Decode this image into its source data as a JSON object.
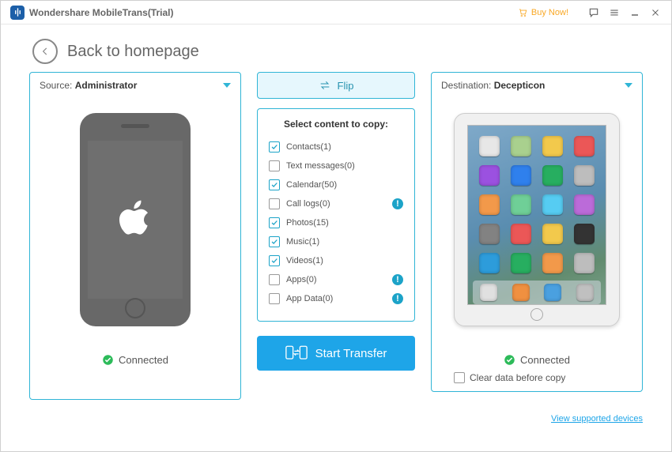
{
  "titlebar": {
    "title": "Wondershare MobileTrans(Trial)",
    "buy": "Buy Now!"
  },
  "back": {
    "label": "Back to homepage"
  },
  "source": {
    "label_prefix": "Source: ",
    "name": "Administrator",
    "status": "Connected"
  },
  "dest": {
    "label_prefix": "Destination: ",
    "name": "Decepticon",
    "status": "Connected",
    "clear_label": "Clear data before copy",
    "clear_checked": false
  },
  "flip": {
    "label": "Flip"
  },
  "content": {
    "title": "Select content to copy:",
    "items": [
      {
        "label": "Contacts(1)",
        "checked": true,
        "info": false
      },
      {
        "label": "Text messages(0)",
        "checked": false,
        "info": false
      },
      {
        "label": "Calendar(50)",
        "checked": true,
        "info": false
      },
      {
        "label": "Call logs(0)",
        "checked": false,
        "info": true
      },
      {
        "label": "Photos(15)",
        "checked": true,
        "info": false
      },
      {
        "label": "Music(1)",
        "checked": true,
        "info": false
      },
      {
        "label": "Videos(1)",
        "checked": true,
        "info": false
      },
      {
        "label": "Apps(0)",
        "checked": false,
        "info": true
      },
      {
        "label": "App Data(0)",
        "checked": false,
        "info": true
      }
    ]
  },
  "start": {
    "label": "Start Transfer"
  },
  "footer": {
    "link": "View supported devices"
  },
  "ipad_colors": [
    "#e7e7e7",
    "#a9d08e",
    "#f2c94c",
    "#eb5757",
    "#9b51e0",
    "#2f80ed",
    "#27ae60",
    "#bdbdbd",
    "#f2994a",
    "#6fcf97",
    "#56ccf2",
    "#bb6bd9",
    "#828282",
    "#eb5757",
    "#f2c94c",
    "#333333",
    "#2d9cdb",
    "#27ae60",
    "#f2994a",
    "#bdbdbd"
  ],
  "dock_colors": [
    "#e0e0e0",
    "#f09040",
    "#4aa0e0",
    "#c0c0c0"
  ]
}
